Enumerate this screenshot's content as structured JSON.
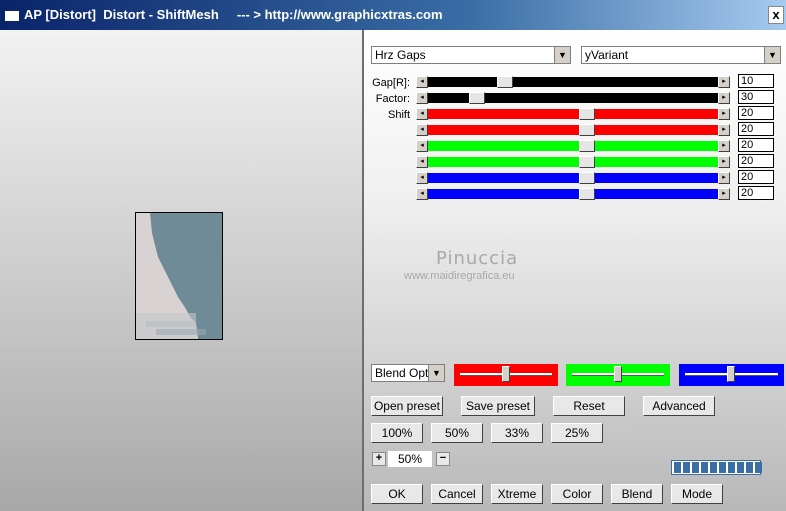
{
  "window": {
    "title": "AP [Distort]  Distort - ShiftMesh     --- > http://www.graphicxtras.com",
    "close_label": "x"
  },
  "selects": {
    "mode": "Hrz Gaps",
    "variant": "yVariant",
    "blend": "Blend Optio"
  },
  "param_labels": {
    "gap": "Gap[R]:",
    "factor": "Factor:",
    "shift": "Shift"
  },
  "sliders": [
    {
      "name": "gap",
      "color": "#000000",
      "value": "10",
      "position": 0.25
    },
    {
      "name": "factor",
      "color": "#000000",
      "value": "30",
      "position": 0.15
    },
    {
      "name": "shift-red-1",
      "color": "#ff0000",
      "value": "20",
      "position": 0.55
    },
    {
      "name": "shift-red-2",
      "color": "#ff0000",
      "value": "20",
      "position": 0.55
    },
    {
      "name": "shift-green-1",
      "color": "#00ff00",
      "value": "20",
      "position": 0.55
    },
    {
      "name": "shift-green-2",
      "color": "#00ff00",
      "value": "20",
      "position": 0.55
    },
    {
      "name": "shift-blue-1",
      "color": "#0000ff",
      "value": "20",
      "position": 0.55
    },
    {
      "name": "shift-blue-2",
      "color": "#0000ff",
      "value": "20",
      "position": 0.55
    }
  ],
  "watermark": {
    "name": "Pinuccia",
    "site": "www.maidiregrafica.eu"
  },
  "color_sliders": [
    {
      "name": "red",
      "color": "#ff0000",
      "position": 0.5
    },
    {
      "name": "green",
      "color": "#00ff00",
      "position": 0.5
    },
    {
      "name": "blue",
      "color": "#0000ff",
      "position": 0.5
    }
  ],
  "buttons": {
    "open_preset": "Open preset",
    "save_preset": "Save preset",
    "reset": "Reset",
    "advanced": "Advanced",
    "z100": "100%",
    "z50": "50%",
    "z33": "33%",
    "z25": "25%",
    "ok": "OK",
    "cancel": "Cancel",
    "xtreme": "Xtreme",
    "color": "Color",
    "blend": "Blend",
    "mode": "Mode"
  },
  "zoom": {
    "value": "50%",
    "plus": "+",
    "minus": "−"
  },
  "progress_segments": 10
}
